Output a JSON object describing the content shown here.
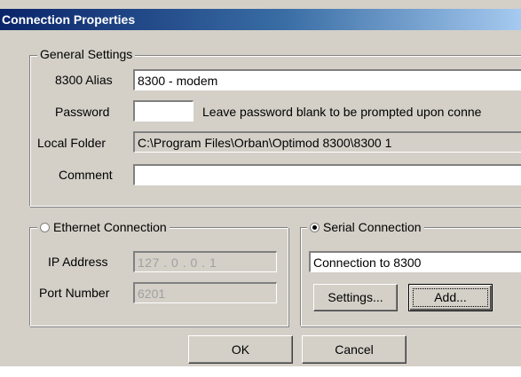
{
  "window": {
    "title": "Connection Properties"
  },
  "general": {
    "title": "General Settings",
    "alias_label": "8300 Alias",
    "alias_value": "8300 - modem",
    "password_label": "Password",
    "password_value": "",
    "password_hint": "Leave password blank to be prompted upon conne",
    "folder_label": "Local Folder",
    "folder_value": "C:\\Program Files\\Orban\\Optimod 8300\\8300 1",
    "comment_label": "Comment",
    "comment_value": ""
  },
  "ethernet": {
    "title": "Ethernet Connection",
    "selected": false,
    "ip_label": "IP Address",
    "ip_value": "127 .  0  .  0  .  1",
    "port_label": "Port Number",
    "port_value": "6201"
  },
  "serial": {
    "title": "Serial Connection",
    "selected": true,
    "connection_value": "Connection to 8300",
    "settings_label": "Settings...",
    "add_label": "Add..."
  },
  "buttons": {
    "ok": "OK",
    "cancel": "Cancel"
  },
  "colors": {
    "face": "#d4d0c8",
    "title_start": "#0a246a",
    "title_end": "#a6caf0",
    "disabled_text": "#a0a0a0"
  }
}
